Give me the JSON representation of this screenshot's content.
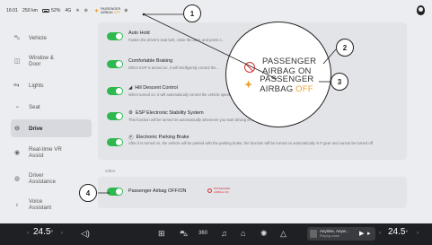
{
  "status": {
    "time": "16:01",
    "range": "250 km",
    "battery": "52%",
    "signal": "4G",
    "pab_line1": "PASSENGER",
    "pab_line2": "AIRBAG",
    "pab_state": "OFF"
  },
  "sidebar": {
    "items": [
      {
        "label": "Vehicle",
        "icon": "car-icon"
      },
      {
        "label": "Window & Door",
        "icon": "window-icon"
      },
      {
        "label": "Lights",
        "icon": "light-icon"
      },
      {
        "label": "Seat",
        "icon": "seat-icon"
      },
      {
        "label": "Drive",
        "icon": "steering-wheel-icon",
        "active": true
      },
      {
        "label": "Real-time VR Assist",
        "icon": "vr-icon"
      },
      {
        "label": "Driver Assistance",
        "icon": "assist-icon"
      },
      {
        "label": "Voice Assistant",
        "icon": "mic-icon"
      }
    ]
  },
  "settings": {
    "auto_hold_title": "Auto Hold",
    "auto_hold_desc": "Fasten the driver's seat belt, close the door, and press t...",
    "comfort_brake_title": "Comfortable Braking",
    "comfort_brake_desc": "When ESP is turned on, it will intelligently control the...",
    "hdc_title": "Hill Descent Control",
    "hdc_desc": "When turned on, it will automatically control the vehicle speed when going downhill",
    "esp_title": "ESP Electronic Stability System",
    "esp_desc": "This function will be turned on automatically whenever you start driving or drive at high speeds",
    "epb_title": "Electronic Parking Brake",
    "epb_desc": "After it is turned on, the vehicle will be parked with the parking brake; the function will be turned on automatically in P gear and cannot be turned off",
    "other_label": "Other",
    "pab_toggle_title": "Passenger Airbag OFF/ON",
    "pab_mini_line1": "PASSENGER",
    "pab_mini_line2": "AIRBAG ON"
  },
  "callout": {
    "on_line1": "PASSENGER",
    "on_line2": "AIRBAG ON",
    "off_line1": "PASSENGER",
    "off_line2": "AIRBAG",
    "off_state": "OFF"
  },
  "badges": [
    "1",
    "2",
    "3",
    "4"
  ],
  "bottombar": {
    "left_temp": "24.5",
    "right_temp": "24.5",
    "temp_unit": "°",
    "temp_sub": "°C",
    "song": "Anytime, Anyw...",
    "artist": "Playing music"
  },
  "colors": {
    "toggle_on": "#2fb84f",
    "airbag_on_red": "#d33333",
    "airbag_off_orange": "#f0a030"
  }
}
